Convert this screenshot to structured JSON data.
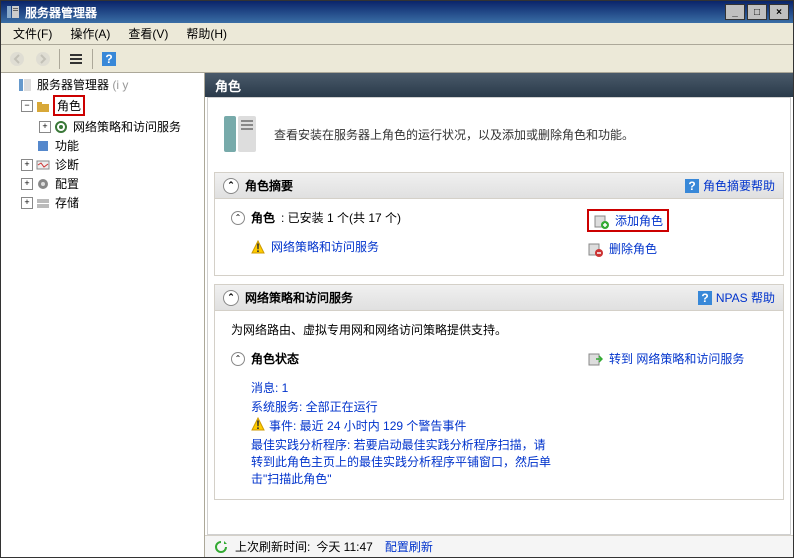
{
  "window": {
    "title": "服务器管理器"
  },
  "menu": {
    "file": "文件(F)",
    "action": "操作(A)",
    "view": "查看(V)",
    "help": "帮助(H)"
  },
  "tree": {
    "root": "服务器管理器",
    "root_suffix": " (i                    y",
    "roles": "角色",
    "npas": "网络策略和访问服务",
    "features": "功能",
    "diagnostics": "诊断",
    "configuration": "配置",
    "storage": "存储"
  },
  "content": {
    "header": "角色",
    "intro": "查看安装在服务器上角色的运行状况，以及添加或删除角色和功能。"
  },
  "summary": {
    "title": "角色摘要",
    "help": "角色摘要帮助",
    "roles_label": "角色",
    "roles_count": ": 已安装 1 个(共 17 个)",
    "role1": "网络策略和访问服务",
    "add_role": "添加角色",
    "remove_role": "删除角色"
  },
  "npas_section": {
    "title": "网络策略和访问服务",
    "help": "NPAS 帮助",
    "desc": "为网络路由、虚拟专用网和网络访问策略提供支持。",
    "status_title": "角色状态",
    "goto": "转到 网络策略和访问服务",
    "messages_label": "消息",
    "messages_count": ": 1",
    "services_label": "系统服务",
    "services_status": ": 全部正在运行",
    "events_label": "事件",
    "events_desc": ": 最近 24 小时内 129 个警告事件",
    "bpa_label": "最佳实践分析程序",
    "bpa_desc": ": 若要启动最佳实践分析程序扫描，请转到此角色主页上的最佳实践分析程序平铺窗口，然后单击\"扫描此角色\""
  },
  "footer": {
    "last_refresh_label": "上次刷新时间: ",
    "last_refresh_value": "今天 11:47",
    "configure_refresh": "配置刷新"
  }
}
